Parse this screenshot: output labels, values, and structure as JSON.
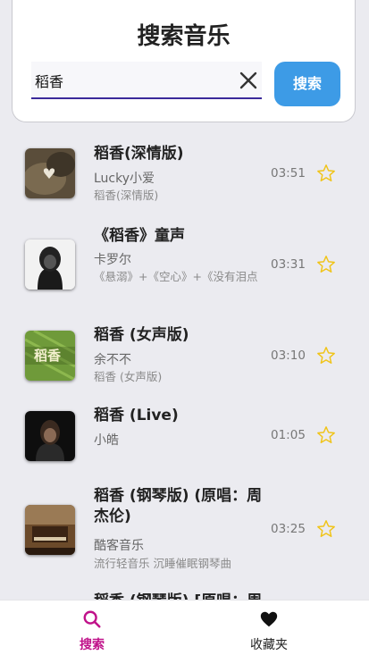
{
  "search": {
    "title": "搜索音乐",
    "query": "稻香",
    "button_label": "搜索"
  },
  "results": [
    {
      "title": "稻香(深情版)",
      "artist": "Lucky小爱",
      "album": "稻香(深情版)",
      "duration": "03:51"
    },
    {
      "title": "《稻香》童声",
      "artist": "卡罗尔",
      "album": "《悬溺》+《空心》+《没有泪点",
      "duration": "03:31"
    },
    {
      "title": "稻香 (女声版)",
      "artist": "余不不",
      "album": "稻香 (女声版)",
      "duration": "03:10"
    },
    {
      "title": "稻香 (Live)",
      "artist": "小皓",
      "album": "",
      "duration": "01:05"
    },
    {
      "title": "稻香 (钢琴版) (原唱：周杰伦)",
      "artist": "酷客音乐",
      "album": "流行轻音乐 沉睡催眠钢琴曲",
      "duration": "03:25"
    },
    {
      "title": "稻香 (钢琴版) [原唱：周",
      "artist": "",
      "album": "",
      "duration": ""
    }
  ],
  "cover_text": "稻香",
  "nav": {
    "search_label": "搜索",
    "favorites_label": "收藏夹",
    "active_color": "#c0128a"
  },
  "colors": {
    "star": "#f0c419",
    "accent": "#3d9be6"
  }
}
